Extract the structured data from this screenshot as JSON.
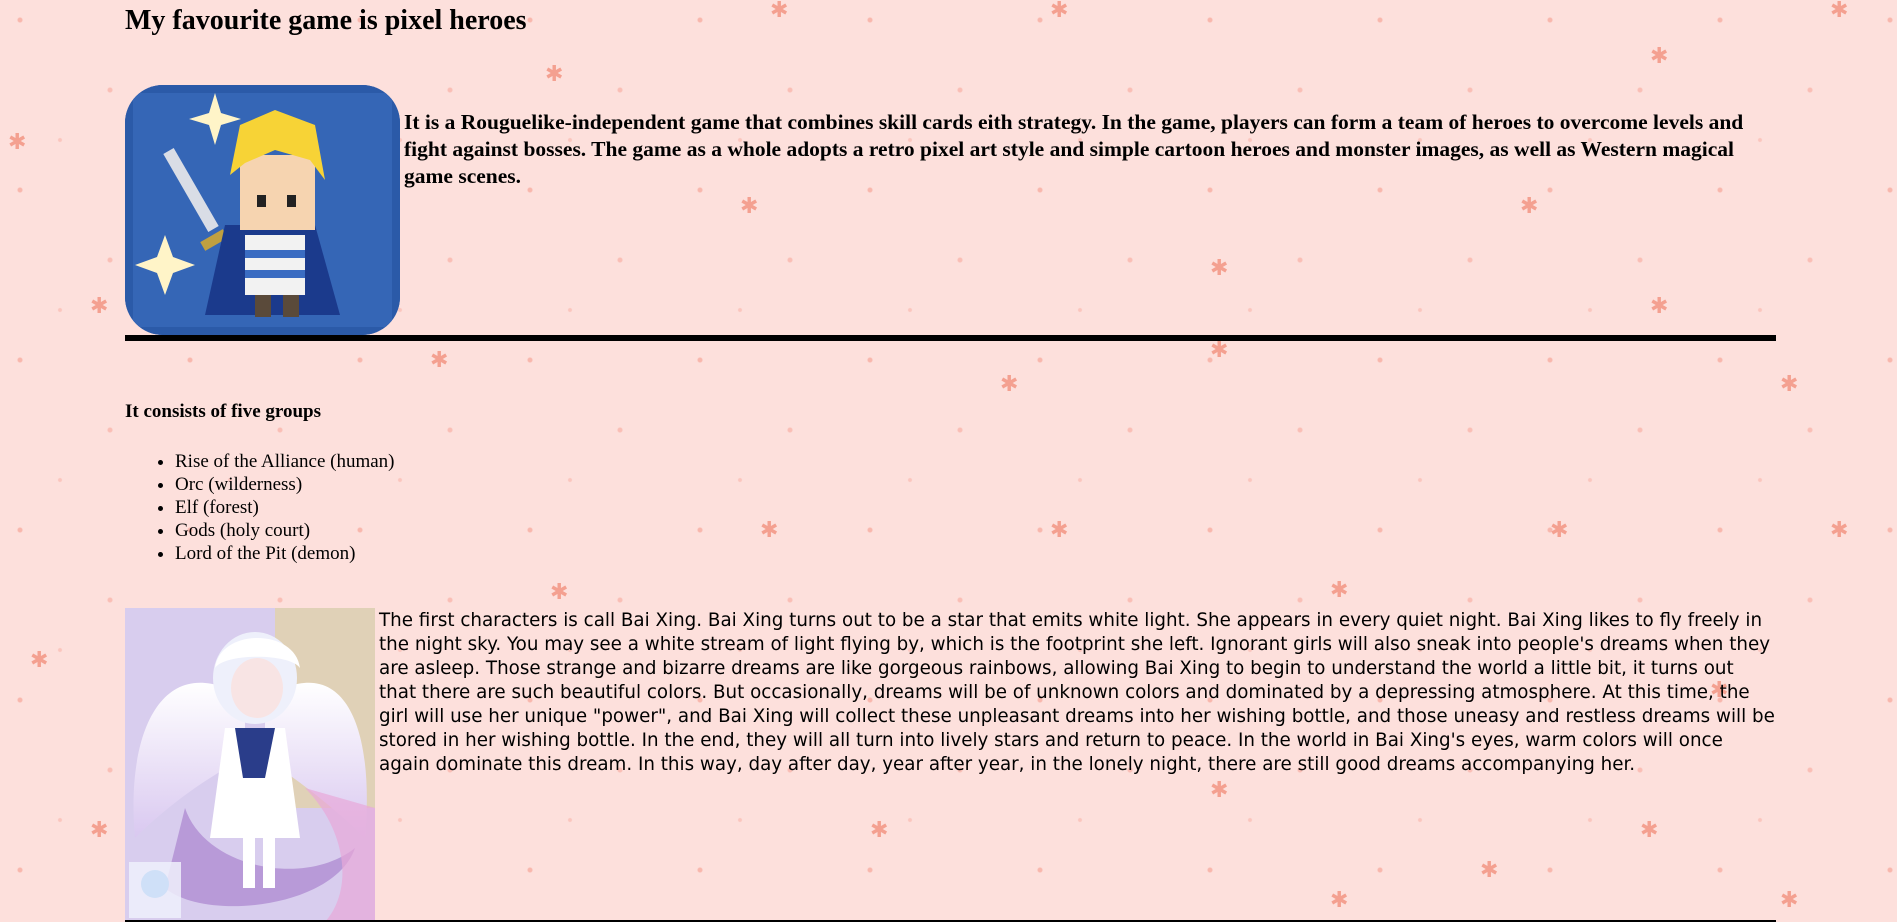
{
  "page": {
    "title": "My favourite game is pixel heroes",
    "intro": "It is a Rouguelike-independent game that combines skill cards eith strategy. In the game, players can form a team of heroes to overcome levels and fight against bosses. The game as a whole adopts a retro pixel art style and simple cartoon heroes and monster images, as well as Western magical game scenes.",
    "groups_heading": "It consists of five groups",
    "groups": [
      "Rise of the Alliance (human)",
      "Orc (wilderness)",
      "Elf (forest)",
      "Gods (holy court)",
      "Lord of the Pit (demon)"
    ],
    "character_text": "The first characters is call Bai Xing. Bai Xing turns out to be a star that emits white light. She appears in every quiet night. Bai Xing likes to fly freely in the night sky. You may see a white stream of light flying by, which is the footprint she left. Ignorant girls will also sneak into people's dreams when they are asleep. Those strange and bizarre dreams are like gorgeous rainbows, allowing Bai Xing to begin to understand the world a little bit, it turns out that there are such beautiful colors. But occasionally, dreams will be of unknown colors and dominated by a depressing atmosphere. At this time, the girl will use her unique \"power\", and Bai Xing will collect these unpleasant dreams into her wishing bottle, and those uneasy and restless dreams will be stored in her wishing bottle. In the end, they will all turn into lively stars and return to peace. In the world in Bai Xing's eyes, warm colors will once again dominate this dream. In this way, day after day, year after year, in the lonely night, there are still good dreams accompanying her."
  },
  "colors": {
    "background": "#fde0dc",
    "accent_star": "#f4a090",
    "rule": "#000000"
  },
  "icons": {
    "background_pattern": "pink-star-pattern",
    "game_icon": "pixel-hero-app-icon",
    "character_art": "bai-xing-angel-illustration"
  }
}
